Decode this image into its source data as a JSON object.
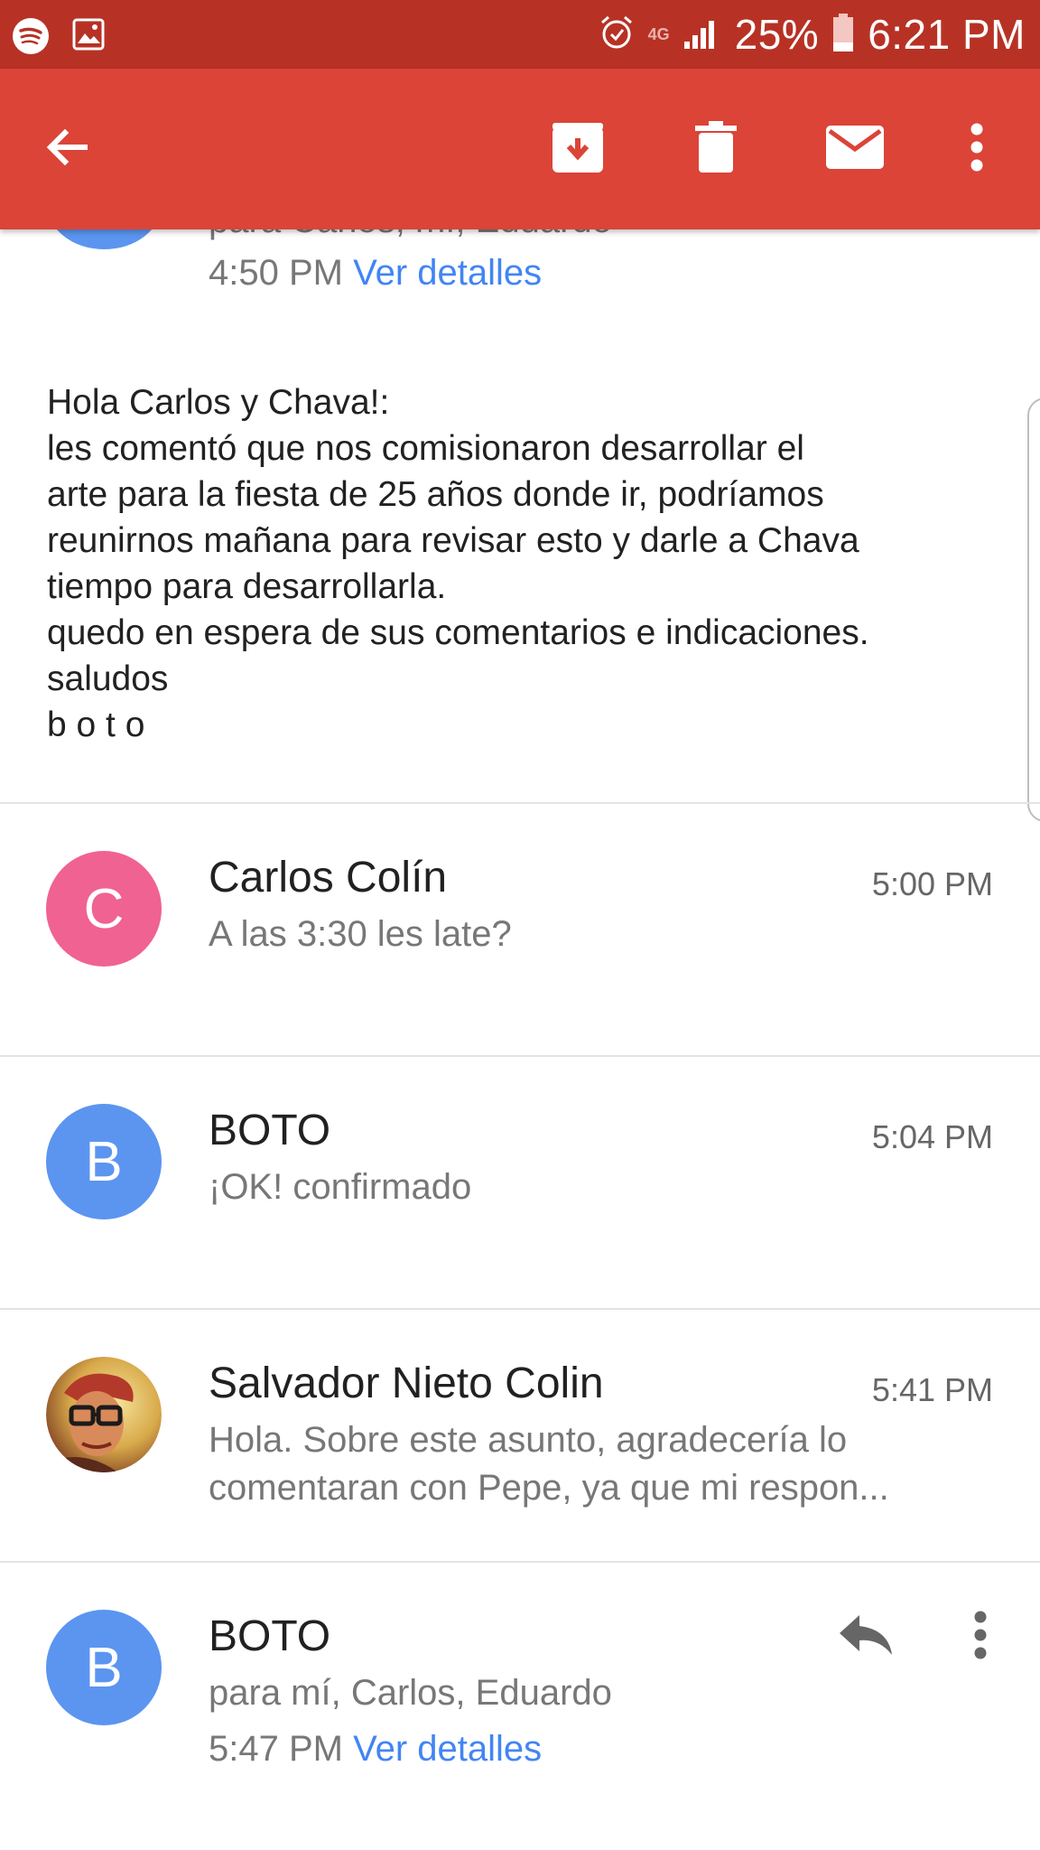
{
  "status_bar": {
    "network": "4G",
    "battery": "25%",
    "time": "6:21 PM",
    "icons": [
      "spotify-icon",
      "gallery-icon",
      "alarm-icon",
      "signal-icon",
      "battery-icon"
    ]
  },
  "app_bar": {
    "icons": [
      "back-arrow-icon",
      "archive-icon",
      "delete-icon",
      "mark-unread-icon",
      "more-vert-icon"
    ],
    "background": "#db4437"
  },
  "top_message": {
    "time": "4:50 PM",
    "details_link": "Ver detalles",
    "avatar_color": "#5b95f0"
  },
  "body": {
    "lines": [
      "Hola Carlos y Chava!:",
      "les comentó que nos comisionaron desarrollar el",
      "arte para la fiesta de 25 años donde ir, podríamos",
      "reunirnos mañana para revisar esto y darle a Chava",
      "tiempo para desarrollarla.",
      "quedo en espera de sus comentarios e indicaciones.",
      "saludos",
      "b o t o"
    ]
  },
  "thread": [
    {
      "initial": "C",
      "avatar_color": "#f06292",
      "sender": "Carlos Colín",
      "time": "5:00 PM",
      "snippet": "A las 3:30 les late?"
    },
    {
      "initial": "B",
      "avatar_color": "#5b95f0",
      "sender": "BOTO",
      "time": "5:04 PM",
      "snippet": "¡OK! confirmado"
    },
    {
      "sender": "Salvador Nieto Colin",
      "time": "5:41 PM",
      "snippet_line1": "Hola. Sobre este asunto, agradecería lo",
      "snippet_line2": "comentaran con Pepe, ya que mi respon..."
    }
  ],
  "last_message": {
    "initial": "B",
    "avatar_color": "#5b95f0",
    "sender": "BOTO",
    "recipients": "para mí, Carlos, Eduardo",
    "time": "5:47 PM",
    "details_link": "Ver detalles",
    "icons": [
      "reply-icon",
      "more-vert-icon"
    ]
  }
}
